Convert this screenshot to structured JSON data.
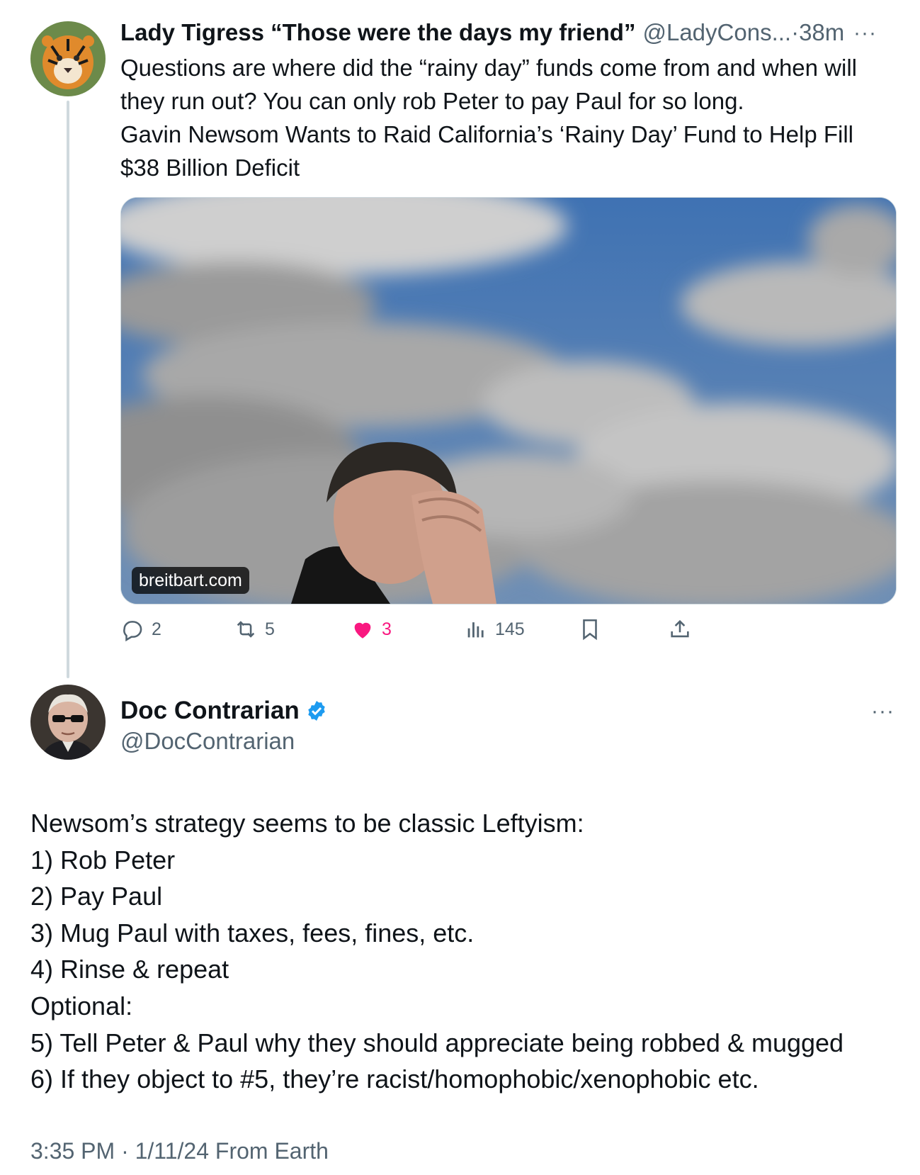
{
  "tweet1": {
    "name": "Lady Tigress “Those were the days my friend”",
    "handle": "@LadyCons...",
    "separator": "·",
    "time": "38m",
    "more": "···",
    "avatar_icon": "tiger-avatar",
    "text_lines": [
      "Questions are where did the “rainy day” funds come from and when will",
      "they run out? You can only rob Peter to pay Paul for so long.",
      "Gavin Newsom Wants to Raid California’s ‘Rainy Day’ Fund to Help Fill",
      "$38 Billion Deficit"
    ],
    "media": {
      "source": "breitbart.com",
      "description_icon": "man-facepalm-photo"
    },
    "actions": {
      "replies": "2",
      "retweets": "5",
      "likes": "3",
      "views": "145"
    }
  },
  "tweet2": {
    "name": "Doc Contrarian",
    "handle": "@DocContrarian",
    "verified_icon": "verified-badge-icon",
    "avatar_icon": "old-man-avatar",
    "more": "···",
    "text_lines": [
      "Newsom’s strategy seems to be classic Leftyism:",
      "1) Rob Peter",
      "2) Pay Paul",
      "3) Mug Paul with taxes, fees, fines, etc.",
      "4) Rinse & repeat",
      "Optional:",
      "5) Tell Peter & Paul why they should appreciate being robbed & mugged",
      "6) If they object to #5, they’re racist/homophobic/xenophobic etc."
    ],
    "meta": "3:35 PM · 1/11/24 From Earth"
  },
  "colors": {
    "text": "#0f1419",
    "secondary": "#536471",
    "like": "#f91880",
    "verified": "#1d9bf0",
    "thread_line": "#cfd9de"
  }
}
